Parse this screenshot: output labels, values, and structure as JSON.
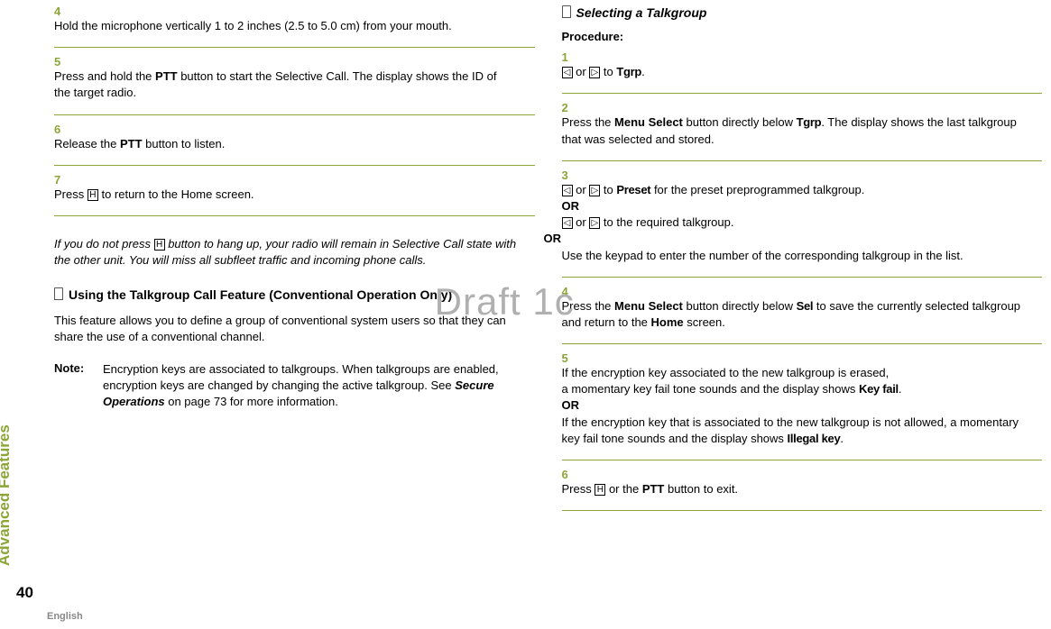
{
  "sidebar": {
    "section_label": "Advanced Features",
    "page_number": "40",
    "english": "English"
  },
  "watermark": "Draft 1c",
  "left": {
    "steps": {
      "s4": {
        "num": "4",
        "text_a": "Hold the microphone vertically 1 to 2 inches (2.5 to 5.0 cm) from your mouth."
      },
      "s5": {
        "num": "5",
        "text_a": "Press and hold the ",
        "ptt": "PTT",
        "text_b": " button to start the Selective Call. The display shows the ID of the target radio."
      },
      "s6": {
        "num": "6",
        "text_a": "Release the ",
        "ptt": "PTT",
        "text_b": " button to listen."
      },
      "s7": {
        "num": "7",
        "text_a": "Press ",
        "home_icon": "H",
        "text_b": " to return to the Home screen."
      }
    },
    "italic_note": {
      "a": "If you do not press ",
      "home_icon": "H",
      "b": " button to hang up, your radio will remain in Selective Call state with the other unit. You will miss all subfleet traffic and incoming phone calls."
    },
    "heading_talkgroup": "Using the Talkgroup Call Feature (Conventional Operation Only)",
    "talkgroup_para": "This feature allows you to define a group of conventional system users so that they can share the use of a conventional channel.",
    "note": {
      "label": "Note:",
      "text_a": "Encryption keys are associated to talkgroups. When talkgroups are enabled, encryption keys are changed by changing the active talkgroup. See ",
      "link": "Secure Operations",
      "text_b": " on page 73 for more information."
    }
  },
  "right": {
    "heading_select": "Selecting a Talkgroup",
    "procedure": "Procedure:",
    "steps": {
      "s1": {
        "num": "1",
        "left_icon": "◁",
        "or": " or ",
        "right_icon": "▷",
        "to": " to ",
        "tgrp": "Tgrp",
        "dot": "."
      },
      "s2": {
        "num": "2",
        "a": "Press the ",
        "ms": "Menu Select",
        "b": " button directly below ",
        "tgrp": "Tgrp",
        "c": ". The display shows the last talkgroup that was selected and stored."
      },
      "s3": {
        "num": "3",
        "left_icon": "◁",
        "or": " or ",
        "right_icon": "▷",
        "to": " to ",
        "preset": "Preset",
        "a": " for the preset preprogrammed talkgroup.",
        "or_line1": "OR",
        "b": " to the required talkgroup.",
        "or_line2": "OR",
        "c": "Use the keypad to enter the number of the corresponding talkgroup in the list."
      },
      "s4": {
        "num": "4",
        "a": "Press the ",
        "ms": "Menu Select",
        "b": " button directly below ",
        "sel": "Sel",
        "c": " to save the currently selected talkgroup and return to the ",
        "home": "Home",
        "d": " screen."
      },
      "s5": {
        "num": "5",
        "a": "If the encryption key associated to the new talkgroup is erased,",
        "b": "a momentary key fail tone sounds and the display shows ",
        "keyfail": "Key fail",
        "dot": ".",
        "or_line": "OR",
        "c": "If the encryption key that is associated to the new talkgroup is not allowed, a momentary key fail tone sounds and the display shows ",
        "illegal": "Illegal key",
        "dot2": "."
      },
      "s6": {
        "num": "6",
        "a": "Press ",
        "home_icon": "H",
        "b": " or the ",
        "ptt": "PTT",
        "c": " button to exit."
      }
    }
  }
}
